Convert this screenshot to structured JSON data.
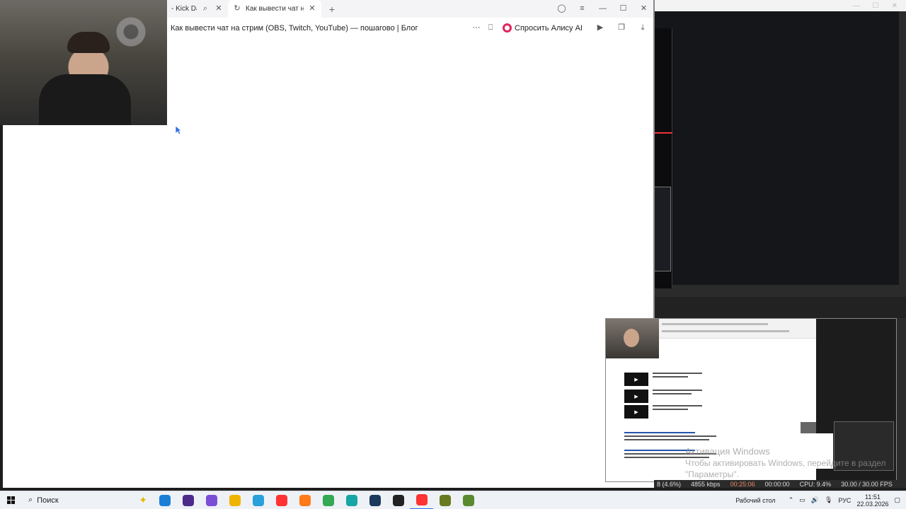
{
  "browser": {
    "tabs": [
      {
        "title": "- Kick Dashb",
        "active": false
      },
      {
        "title": "Как вывести чат на стр",
        "active": true
      }
    ],
    "address_title": "Как вывести чат на стрим (OBS, Twitch, YouTube) — пошагово | Блог",
    "alice_label": "Спросить Алису AI"
  },
  "watermark": {
    "line1": "Активация Windows",
    "line2": "Чтобы активировать Windows, перейдите в раздел \"Параметры\"."
  },
  "obs_status": {
    "dropped": "8 (4.6%)",
    "bitrate": "4855 kbps",
    "stream_time": "00:25:06",
    "rec_time": "00:00:00",
    "cpu": "CPU: 9.4%",
    "fps": "30.00 / 30.00 FPS"
  },
  "taskbar": {
    "search_placeholder": "Поиск",
    "desktop_label": "Рабочий стол",
    "language": "РУС",
    "time": "11:51",
    "date": "22.03.2026",
    "apps": [
      {
        "icon": "edge-icon",
        "color": "#1b7fd6"
      },
      {
        "icon": "media-player-icon",
        "color": "#4b2a8a"
      },
      {
        "icon": "discord-like-icon",
        "color": "#7a4fd6"
      },
      {
        "icon": "file-explorer-icon",
        "color": "#f0b400"
      },
      {
        "icon": "telegram-icon",
        "color": "#2aa0da"
      },
      {
        "icon": "yandex-browser-icon",
        "color": "#ff3333"
      },
      {
        "icon": "firefox-icon",
        "color": "#ff7a18"
      },
      {
        "icon": "chrome-icon",
        "color": "#34a853"
      },
      {
        "icon": "vpn-shield-icon",
        "color": "#16a6a6"
      },
      {
        "icon": "steam-icon",
        "color": "#1b3a5c"
      },
      {
        "icon": "obs-icon",
        "color": "#222222"
      },
      {
        "icon": "yandex-active-icon",
        "color": "#ff3333"
      },
      {
        "icon": "lock-app-icon",
        "color": "#6a7a20"
      },
      {
        "icon": "minecraft-icon",
        "color": "#5a8a2e"
      }
    ]
  }
}
